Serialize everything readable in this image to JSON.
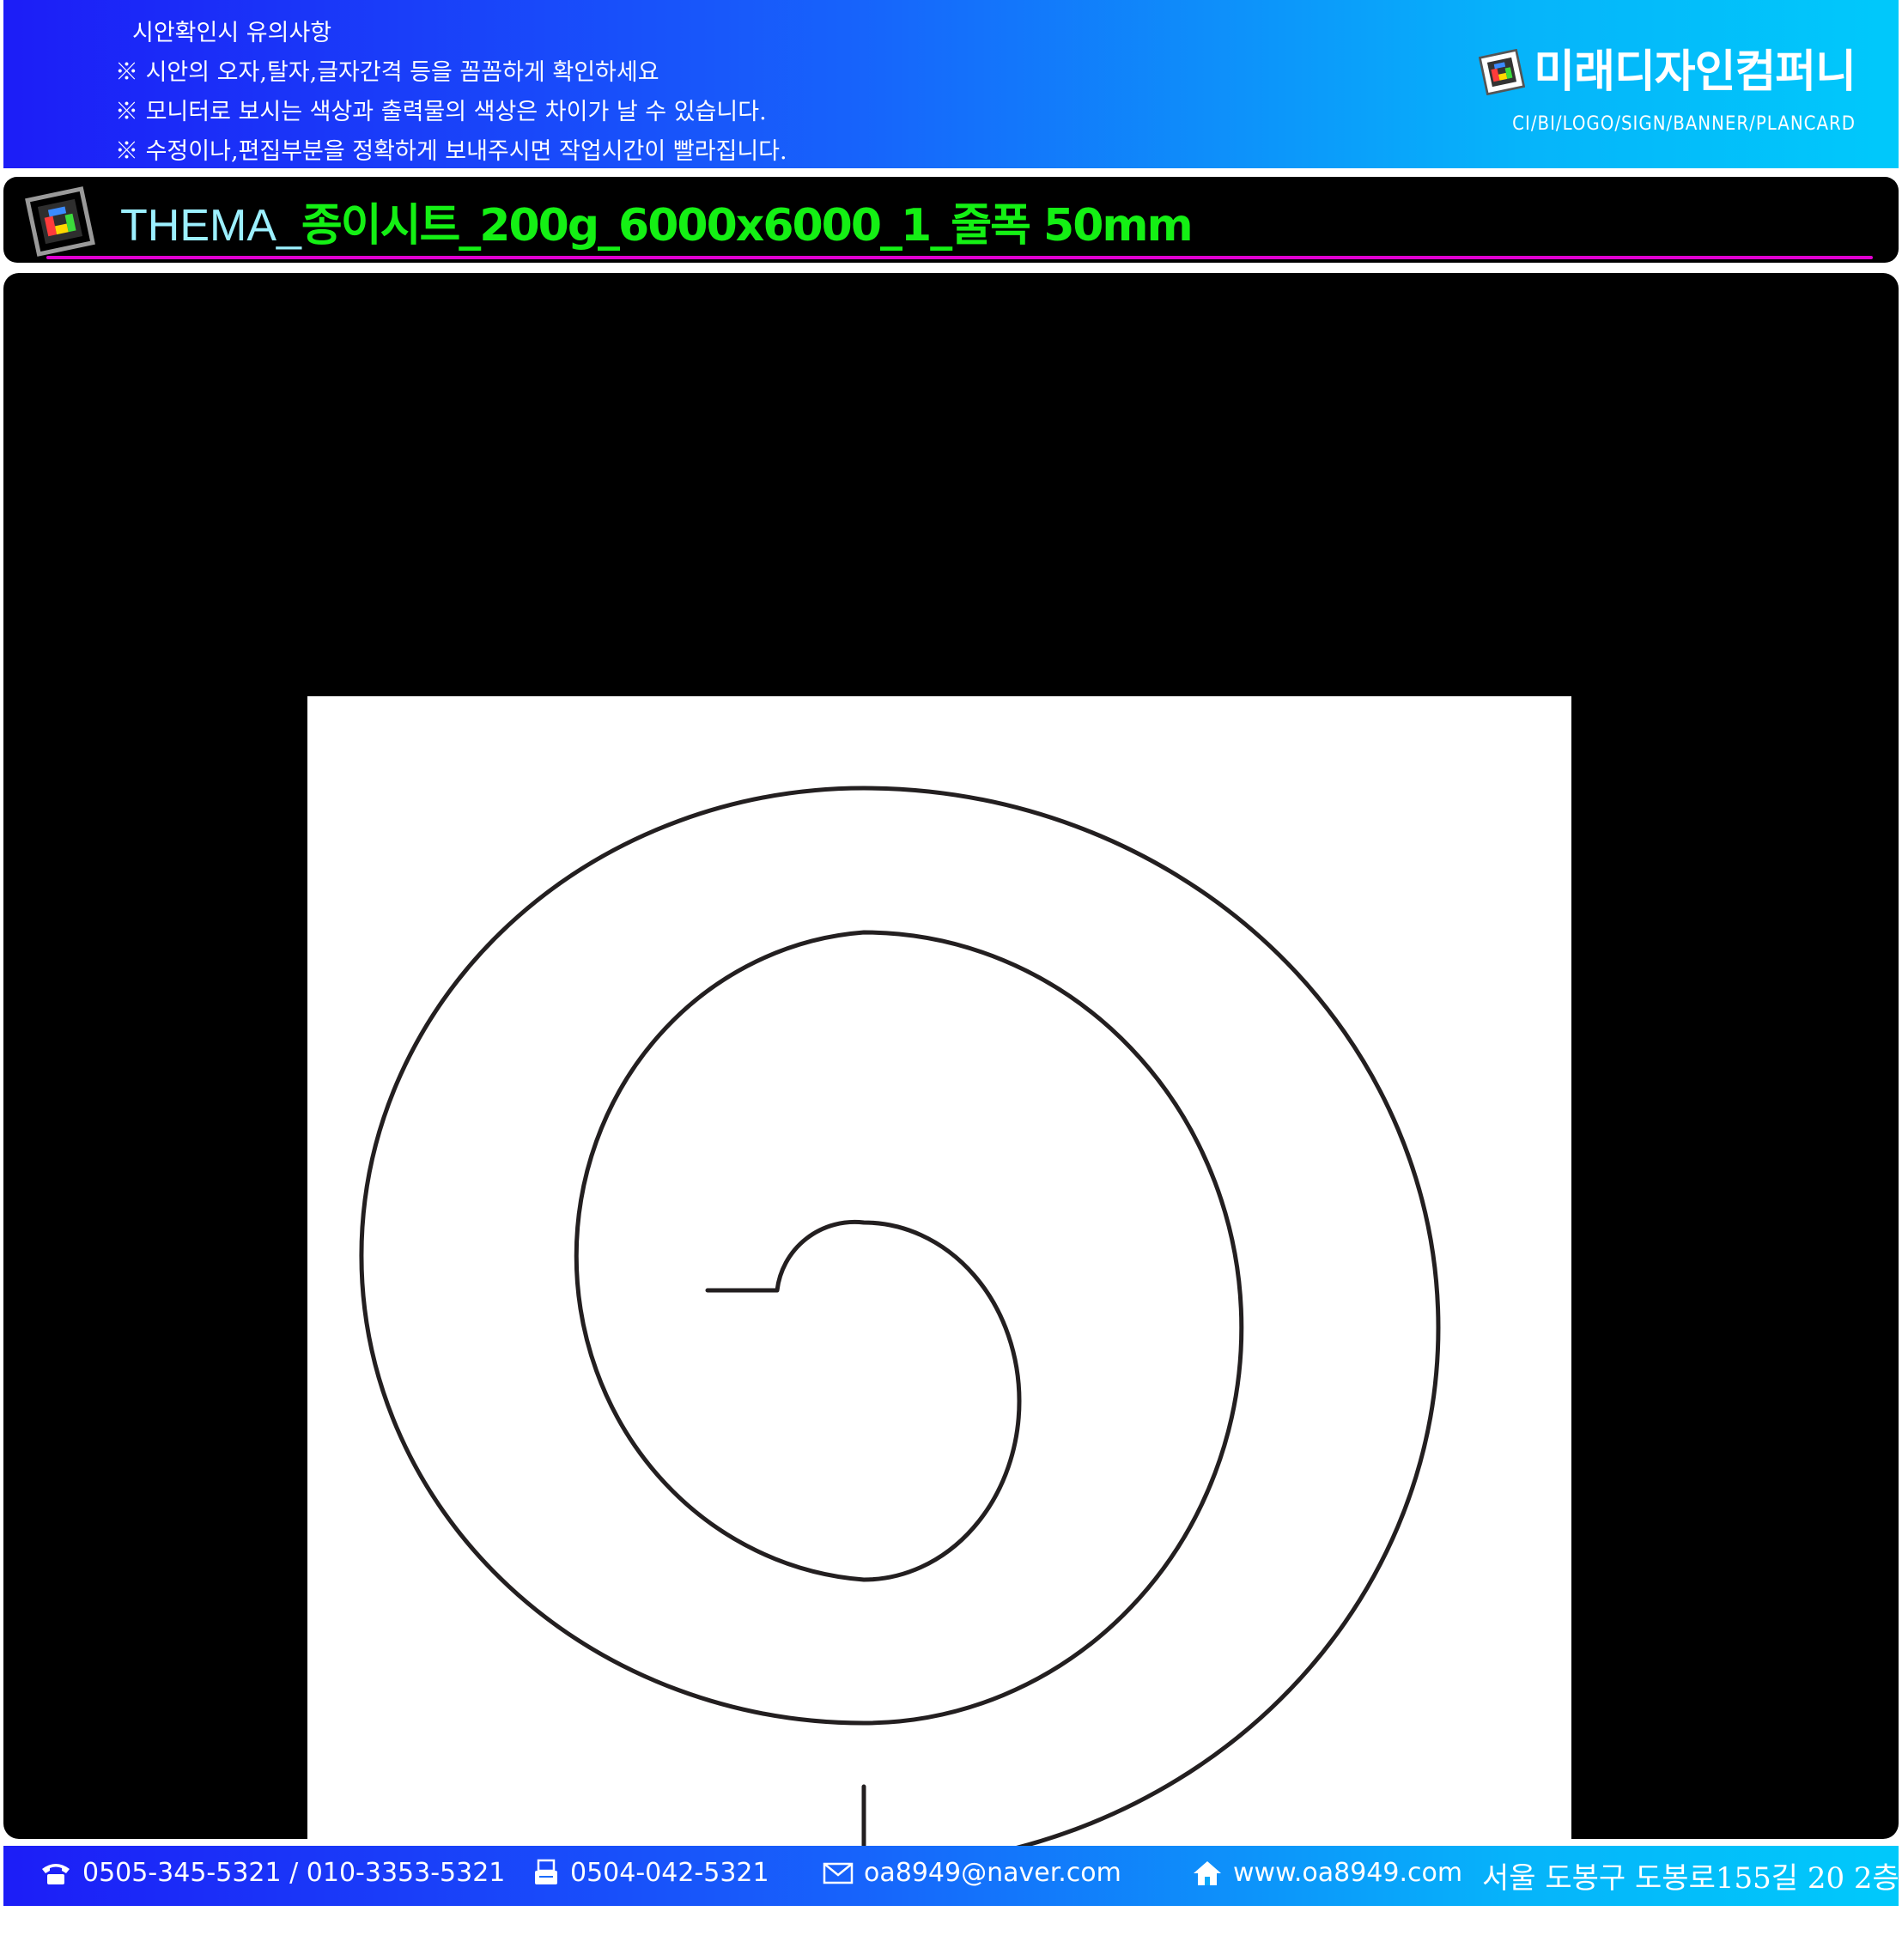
{
  "header": {
    "notice_title": "시안확인시 유의사항",
    "notices": [
      "※ 시안의 오자,탈자,글자간격 등을 꼼꼼하게 확인하세요",
      "※ 모니터로 보시는 색상과  출력물의 색상은 차이가 날 수 있습니다.",
      "※ 수정이나,편집부분을 정확하게 보내주시면 작업시간이 빨라집니다."
    ],
    "brand_name": "미래디자인컴퍼니",
    "brand_sub": "CI/BI/LOGO/SIGN/BANNER/PLANCARD"
  },
  "titlebar": {
    "prefix": "THEMA_",
    "title": "종이시트_200g_6000x6000_1_줄폭 50mm"
  },
  "footer": {
    "phone": "0505-345-5321 / 010-3353-5321",
    "fax": "0504-042-5321",
    "email": "oa8949@naver.com",
    "website": "www.oa8949.com",
    "address": "서울 도봉구 도봉로155길 20 2층"
  },
  "colors": {
    "header_gradient_start": "#1c1df7",
    "header_gradient_end": "#00c9fb",
    "title_prefix": "#9cf0ff",
    "title_main": "#14f014",
    "title_underline": "#e000d0",
    "panel": "#000000",
    "sheet": "#ffffff",
    "spiral_stroke": "#231f20"
  },
  "icons": [
    "logo-icon",
    "phone-icon",
    "fax-icon",
    "mail-icon",
    "home-icon"
  ]
}
